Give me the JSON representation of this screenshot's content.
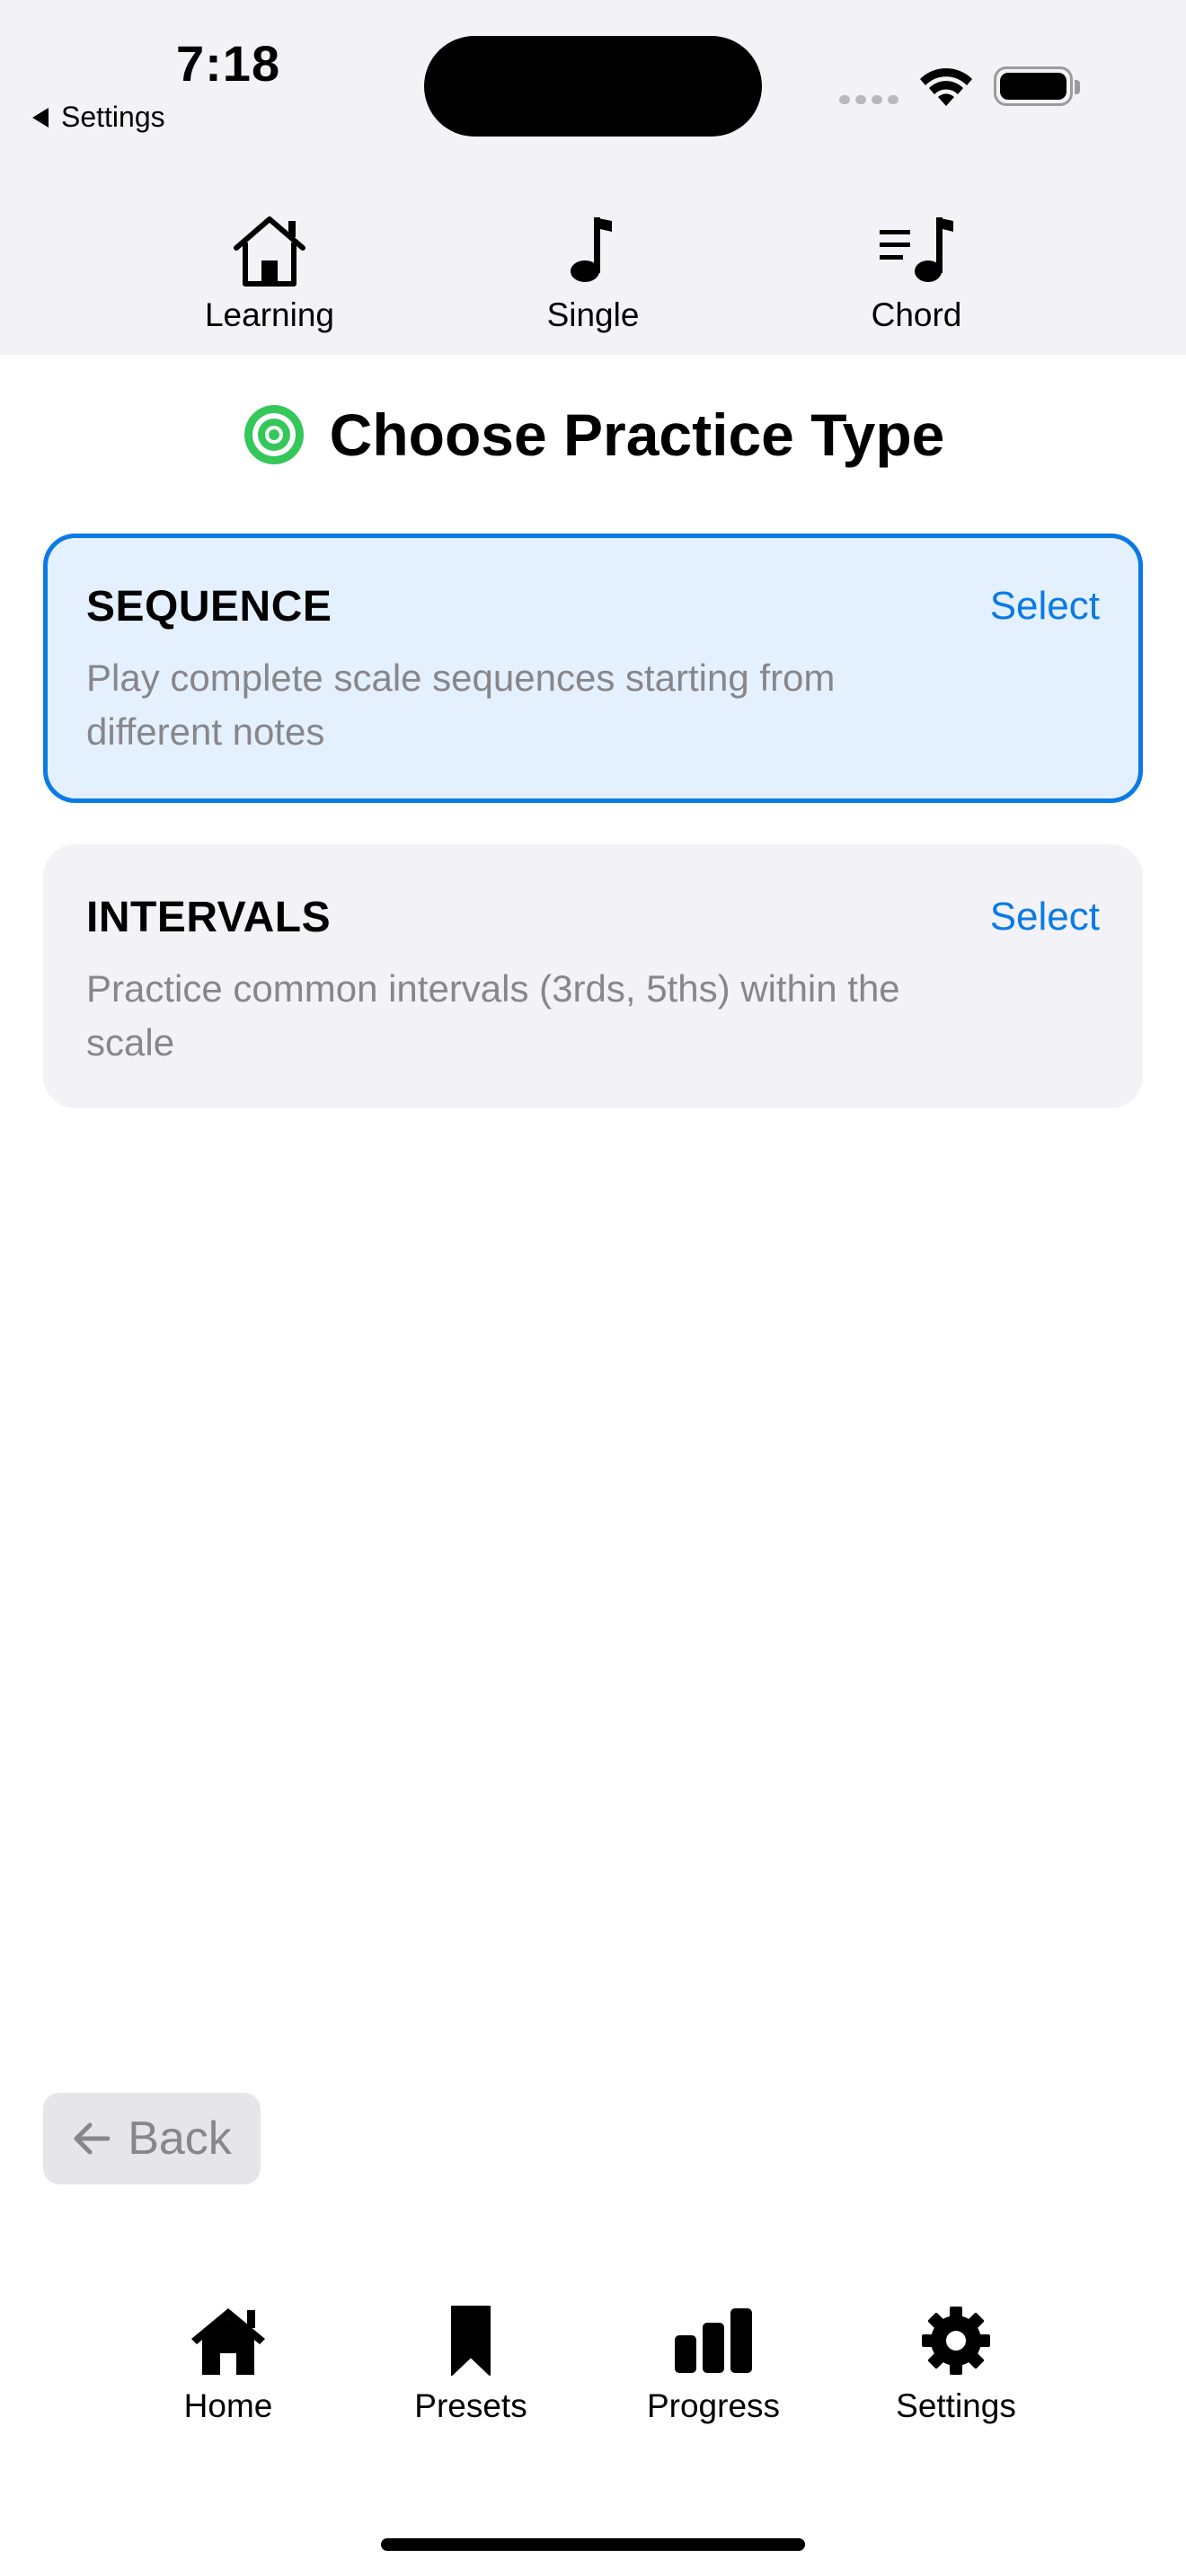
{
  "status_bar": {
    "time": "7:18",
    "back_app": "Settings"
  },
  "mode_tabs": [
    {
      "label": "Learning",
      "icon": "house-icon"
    },
    {
      "label": "Single",
      "icon": "music-note-icon"
    },
    {
      "label": "Chord",
      "icon": "note-list-icon"
    }
  ],
  "heading": {
    "title": "Choose Practice Type",
    "icon": "target-icon"
  },
  "options": [
    {
      "name": "SEQUENCE",
      "action": "Select",
      "description": "Play complete scale sequences starting from different notes",
      "selected": true
    },
    {
      "name": "INTERVALS",
      "action": "Select",
      "description": "Practice common intervals (3rds, 5ths) within the scale",
      "selected": false
    }
  ],
  "back_button": {
    "label": "Back",
    "icon": "arrow-left-icon"
  },
  "tab_bar": [
    {
      "label": "Home",
      "icon": "house-fill-icon"
    },
    {
      "label": "Presets",
      "icon": "bookmark-icon"
    },
    {
      "label": "Progress",
      "icon": "bar-chart-icon"
    },
    {
      "label": "Settings",
      "icon": "gear-icon"
    }
  ],
  "colors": {
    "accent": "#0a7ae6",
    "selected_card_bg": "#e4f0fd",
    "target_icon": "#34c759",
    "secondary_text": "#86868b"
  }
}
